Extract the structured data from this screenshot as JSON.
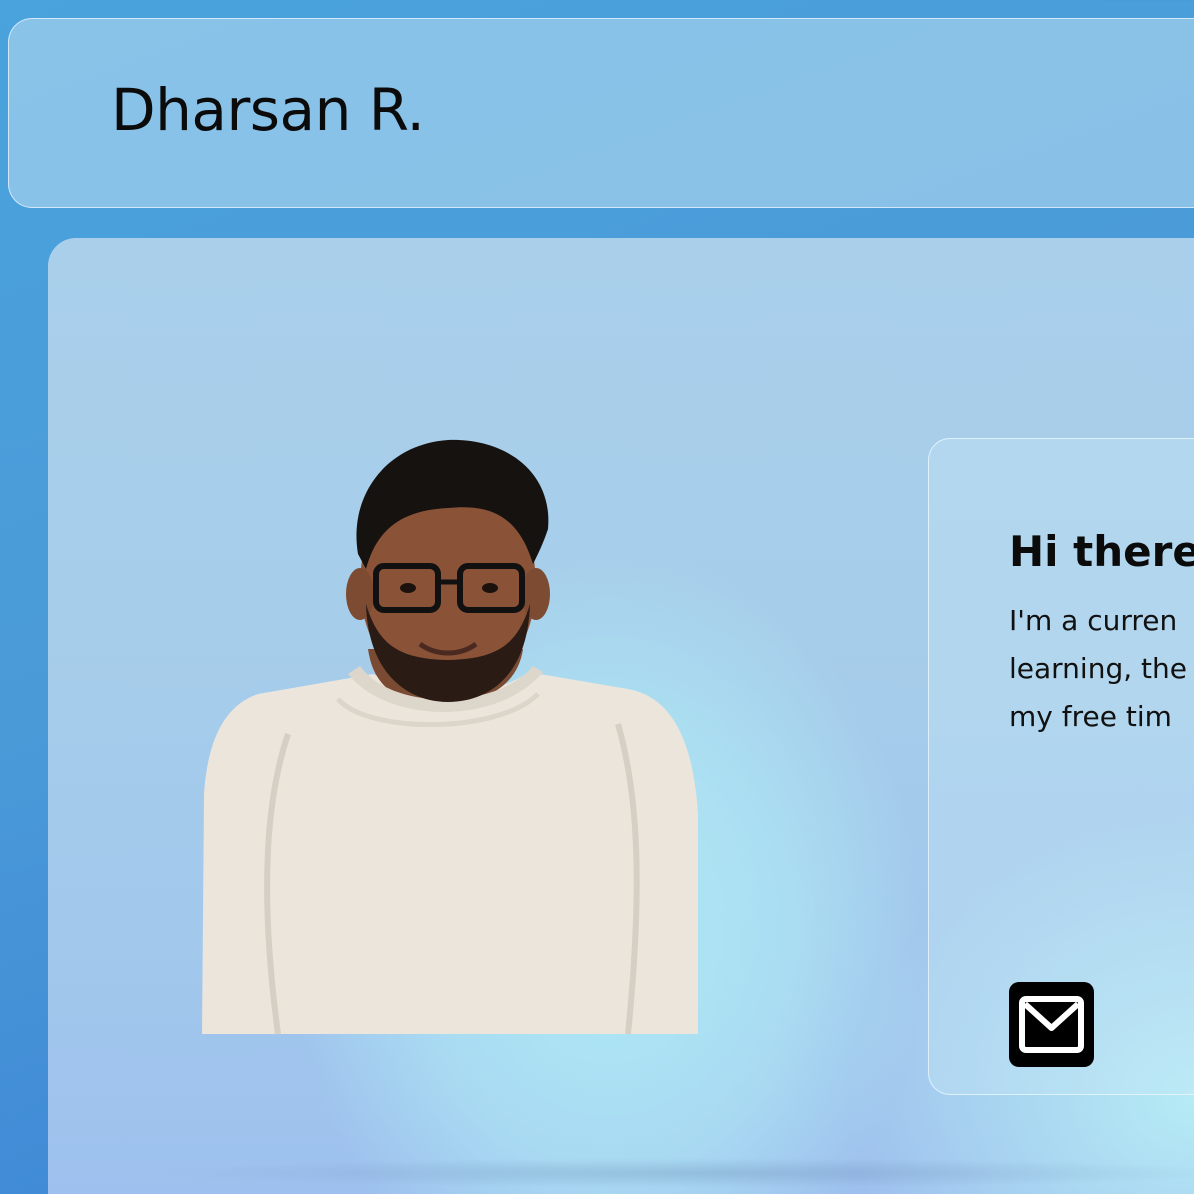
{
  "header": {
    "site_title": "Dharsan R."
  },
  "intro": {
    "heading": "Hi there",
    "body_lines": [
      "I'm a curren",
      "learning, the",
      "my free tim"
    ]
  },
  "contact": {
    "email_icon": "mail-icon"
  },
  "colors": {
    "background": "#4a9ad8",
    "panel": "#a9cfeb",
    "highlight": "#b0ecf6",
    "text": "#0b0b0b"
  }
}
